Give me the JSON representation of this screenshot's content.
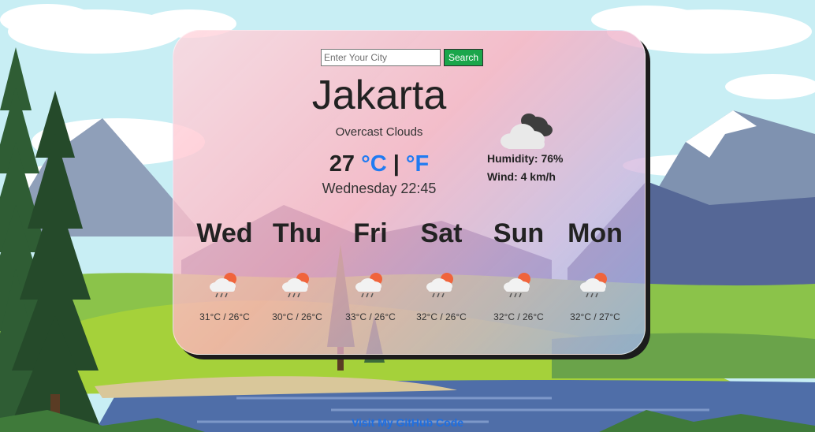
{
  "search": {
    "placeholder": "Enter Your City",
    "value": "",
    "button_label": "Search"
  },
  "current": {
    "city": "Jakarta",
    "description": "Overcast Clouds",
    "temperature": "27",
    "unit_c": "°C",
    "separator": "|",
    "unit_f": "°F",
    "datetime": "Wednesday 22:45",
    "humidity": "Humidity: 76%",
    "wind": "Wind: 4 km/h",
    "icon": "overcast-clouds-icon"
  },
  "forecast": [
    {
      "day": "Wed",
      "temps": "31°C / 26°C",
      "icon": "rain-sun-cloud-icon"
    },
    {
      "day": "Thu",
      "temps": "30°C / 26°C",
      "icon": "rain-sun-cloud-icon"
    },
    {
      "day": "Fri",
      "temps": "33°C / 26°C",
      "icon": "rain-sun-cloud-icon"
    },
    {
      "day": "Sat",
      "temps": "32°C / 26°C",
      "icon": "rain-sun-cloud-icon"
    },
    {
      "day": "Sun",
      "temps": "32°C / 26°C",
      "icon": "rain-sun-cloud-icon"
    },
    {
      "day": "Mon",
      "temps": "32°C / 27°C",
      "icon": "rain-sun-cloud-icon"
    }
  ],
  "footer": {
    "link_text": "Visit My GitHub Code"
  },
  "colors": {
    "unit_link": "#1f7bf2",
    "search_button": "#1aa64b",
    "card_shadow": "#1c1c1c"
  }
}
